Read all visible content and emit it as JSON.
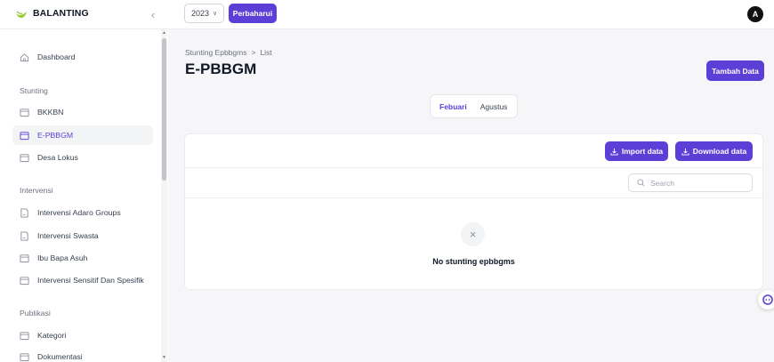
{
  "header": {
    "brand": "BALANTING",
    "year": "2023",
    "refresh_label": "Perbaharui",
    "avatar_initial": "A"
  },
  "sidebar": {
    "top_item": "Dashboard",
    "sections": [
      {
        "label": "Stunting",
        "items": [
          "BKKBN",
          "E-PBBGM",
          "Desa Lokus"
        ]
      },
      {
        "label": "Intervensi",
        "items": [
          "Intervensi Adaro Groups",
          "Intervensi Swasta",
          "Ibu Bapa Asuh",
          "Intervensi Sensitif Dan Spesifik"
        ]
      },
      {
        "label": "Publikasi",
        "items": [
          "Kategori",
          "Dokumentasi"
        ]
      }
    ],
    "active_item": "E-PBBGM"
  },
  "main": {
    "breadcrumb": {
      "parent": "Stunting Epbbgms",
      "separator": ">",
      "current": "List"
    },
    "title": "E-PBBGM",
    "add_label": "Tambah Data",
    "tabs": [
      "Febuari",
      "Agustus"
    ],
    "active_tab": "Febuari",
    "import_label": "Import data",
    "download_label": "Download data",
    "search_placeholder": "Search",
    "empty_message": "No stunting epbbgms"
  },
  "colors": {
    "accent": "#5b3fd6",
    "background": "#f6f6f8",
    "brand_logo": "#9acd32"
  },
  "icons": [
    "leaf-logo-icon",
    "chevron-left-icon",
    "chevron-down-icon",
    "home-icon",
    "folder-icon",
    "document-icon",
    "download-icon",
    "search-icon",
    "close-icon",
    "chat-icon"
  ]
}
